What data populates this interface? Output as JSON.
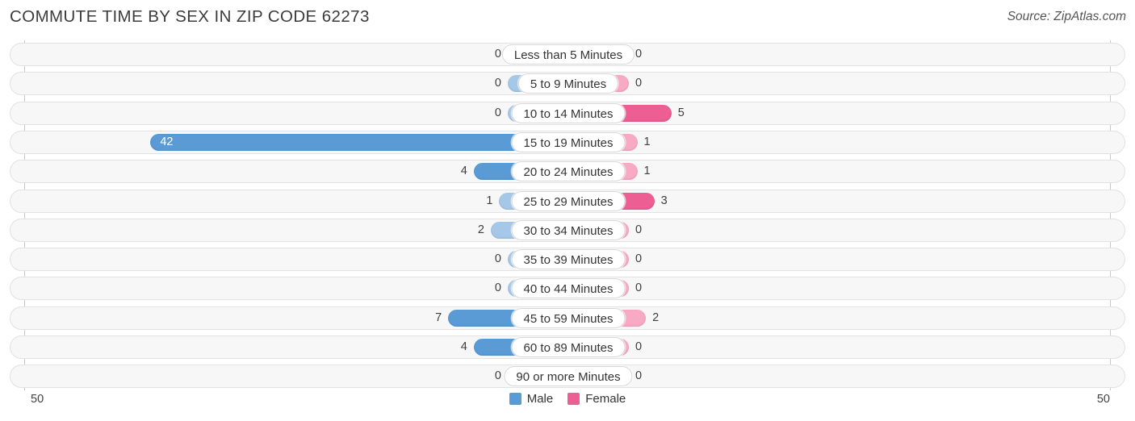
{
  "header": {
    "title": "COMMUTE TIME BY SEX IN ZIP CODE 62273",
    "source": "Source: ZipAtlas.com"
  },
  "legend": {
    "male_label": "Male",
    "female_label": "Female",
    "male_color": "#5B9BD5",
    "female_color": "#ED5E93"
  },
  "axis": {
    "left_label": "50",
    "right_label": "50",
    "max": 50
  },
  "palette": {
    "male_strong": "#5B9BD5",
    "male_light": "#A6C8E8",
    "female_strong": "#ED5E93",
    "female_light": "#F8A9C4",
    "track_fill": "#f7f7f7",
    "track_border": "#e2e2e2"
  },
  "chart_data": {
    "type": "bar",
    "title": "COMMUTE TIME BY SEX IN ZIP CODE 62273",
    "xlabel": "",
    "ylabel": "",
    "orientation": "horizontal-diverging",
    "xlim": [
      50,
      50
    ],
    "grid": false,
    "legend_position": "bottom-center",
    "categories": [
      "Less than 5 Minutes",
      "5 to 9 Minutes",
      "10 to 14 Minutes",
      "15 to 19 Minutes",
      "20 to 24 Minutes",
      "25 to 29 Minutes",
      "30 to 34 Minutes",
      "35 to 39 Minutes",
      "40 to 44 Minutes",
      "45 to 59 Minutes",
      "60 to 89 Minutes",
      "90 or more Minutes"
    ],
    "series": [
      {
        "name": "Male",
        "values": [
          0,
          0,
          0,
          42,
          4,
          1,
          2,
          0,
          0,
          7,
          4,
          0
        ]
      },
      {
        "name": "Female",
        "values": [
          0,
          0,
          5,
          1,
          1,
          3,
          0,
          0,
          0,
          2,
          0,
          0
        ]
      }
    ]
  }
}
